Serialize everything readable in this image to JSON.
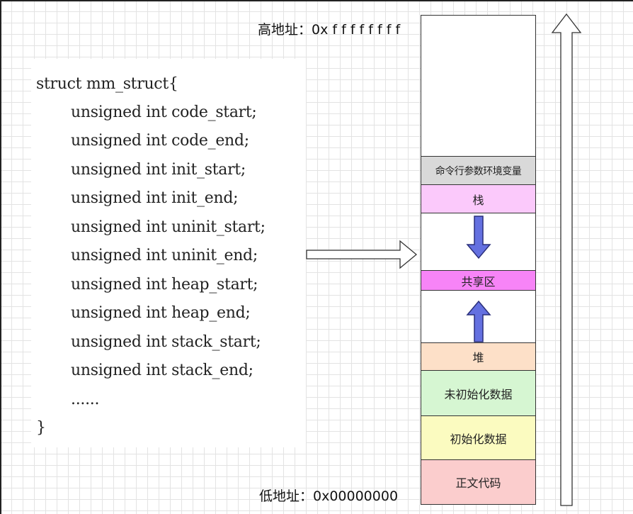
{
  "addresses": {
    "high": "高地址：0x f f f f f f f f",
    "low": "低地址：0x00000000"
  },
  "code": {
    "lines": [
      "struct mm_struct{",
      "unsigned int code_start;",
      "unsigned int code_end;",
      "unsigned int init_start;",
      "unsigned int init_end;",
      "unsigned int uninit_start;",
      "unsigned int uninit_end;",
      "unsigned int heap_start;",
      "unsigned int heap_end;",
      "unsigned int stack_start;",
      "unsigned int stack_end;",
      "......",
      "}"
    ]
  },
  "memory": {
    "segments": [
      {
        "key": "top",
        "label": "",
        "color": "#ffffff"
      },
      {
        "key": "args-env",
        "label": "命令行参数环境变量",
        "color": "#d9d9d9"
      },
      {
        "key": "stack",
        "label": "栈",
        "color": "#fbc9fb"
      },
      {
        "key": "gap-upper",
        "label": "",
        "color": "#ffffff"
      },
      {
        "key": "shared",
        "label": "共享区",
        "color": "#f784f7"
      },
      {
        "key": "gap-lower",
        "label": "",
        "color": "#ffffff"
      },
      {
        "key": "heap",
        "label": "堆",
        "color": "#fde0c8"
      },
      {
        "key": "bss",
        "label": "未初始化数据",
        "color": "#d6f6d2"
      },
      {
        "key": "data",
        "label": "初始化数据",
        "color": "#fbfbc0"
      },
      {
        "key": "text",
        "label": "正文代码",
        "color": "#fbcdcd"
      }
    ]
  },
  "colors": {
    "growth_arrow_fill": "#6470e0",
    "growth_arrow_stroke": "#2a2f7a",
    "outline": "#333333"
  },
  "icons": {
    "mapping_arrow": "right-hollow-arrow-icon",
    "stack_growth": "down-arrow-icon",
    "heap_growth": "up-arrow-icon",
    "address_direction": "up-hollow-arrow-icon"
  }
}
